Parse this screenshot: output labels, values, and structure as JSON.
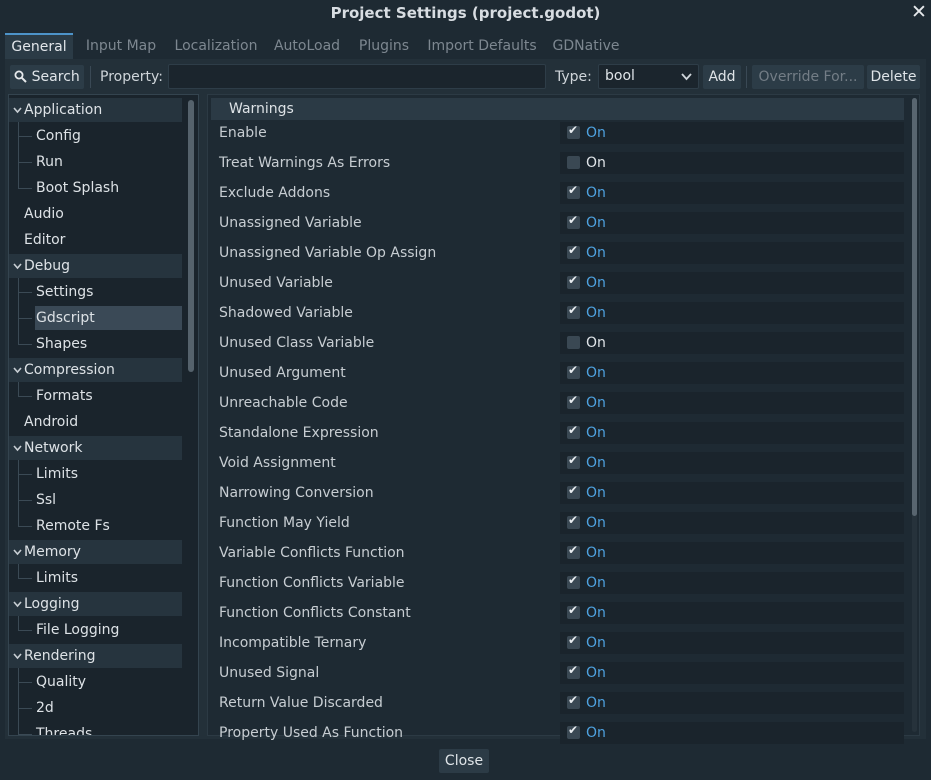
{
  "window": {
    "title": "Project Settings (project.godot)",
    "close_symbol": "✕"
  },
  "tabs": [
    {
      "label": "General",
      "active": true
    },
    {
      "label": "Input Map"
    },
    {
      "label": "Localization"
    },
    {
      "label": "AutoLoad"
    },
    {
      "label": "Plugins"
    },
    {
      "label": "Import Defaults"
    },
    {
      "label": "GDNative"
    }
  ],
  "toolbar": {
    "search_label": "Search",
    "property_label": "Property:",
    "property_value": "",
    "type_label": "Type:",
    "type_value": "bool",
    "add_label": "Add",
    "override_label": "Override For...",
    "delete_label": "Delete"
  },
  "tree": [
    {
      "label": "Application",
      "level": 0,
      "section": true
    },
    {
      "label": "Config",
      "level": 1
    },
    {
      "label": "Run",
      "level": 1
    },
    {
      "label": "Boot Splash",
      "level": 1
    },
    {
      "label": "Audio",
      "level": 0
    },
    {
      "label": "Editor",
      "level": 0
    },
    {
      "label": "Debug",
      "level": 0,
      "section": true
    },
    {
      "label": "Settings",
      "level": 1
    },
    {
      "label": "Gdscript",
      "level": 1,
      "selected": true
    },
    {
      "label": "Shapes",
      "level": 1
    },
    {
      "label": "Compression",
      "level": 0,
      "section": true
    },
    {
      "label": "Formats",
      "level": 1
    },
    {
      "label": "Android",
      "level": 0
    },
    {
      "label": "Network",
      "level": 0,
      "section": true
    },
    {
      "label": "Limits",
      "level": 1
    },
    {
      "label": "Ssl",
      "level": 1
    },
    {
      "label": "Remote Fs",
      "level": 1
    },
    {
      "label": "Memory",
      "level": 0,
      "section": true
    },
    {
      "label": "Limits",
      "level": 1
    },
    {
      "label": "Logging",
      "level": 0,
      "section": true
    },
    {
      "label": "File Logging",
      "level": 1
    },
    {
      "label": "Rendering",
      "level": 0,
      "section": true
    },
    {
      "label": "Quality",
      "level": 1
    },
    {
      "label": "2d",
      "level": 1
    },
    {
      "label": "Threads",
      "level": 1
    }
  ],
  "inspector": {
    "section_title": "Warnings",
    "properties": [
      {
        "label": "Enable",
        "checked": true,
        "value": "On"
      },
      {
        "label": "Treat Warnings As Errors",
        "checked": false,
        "value": "On"
      },
      {
        "label": "Exclude Addons",
        "checked": true,
        "value": "On"
      },
      {
        "label": "Unassigned Variable",
        "checked": true,
        "value": "On"
      },
      {
        "label": "Unassigned Variable Op Assign",
        "checked": true,
        "value": "On"
      },
      {
        "label": "Unused Variable",
        "checked": true,
        "value": "On"
      },
      {
        "label": "Shadowed Variable",
        "checked": true,
        "value": "On"
      },
      {
        "label": "Unused Class Variable",
        "checked": false,
        "value": "On"
      },
      {
        "label": "Unused Argument",
        "checked": true,
        "value": "On"
      },
      {
        "label": "Unreachable Code",
        "checked": true,
        "value": "On"
      },
      {
        "label": "Standalone Expression",
        "checked": true,
        "value": "On"
      },
      {
        "label": "Void Assignment",
        "checked": true,
        "value": "On"
      },
      {
        "label": "Narrowing Conversion",
        "checked": true,
        "value": "On"
      },
      {
        "label": "Function May Yield",
        "checked": true,
        "value": "On"
      },
      {
        "label": "Variable Conflicts Function",
        "checked": true,
        "value": "On"
      },
      {
        "label": "Function Conflicts Variable",
        "checked": true,
        "value": "On"
      },
      {
        "label": "Function Conflicts Constant",
        "checked": true,
        "value": "On"
      },
      {
        "label": "Incompatible Ternary",
        "checked": true,
        "value": "On"
      },
      {
        "label": "Unused Signal",
        "checked": true,
        "value": "On"
      },
      {
        "label": "Return Value Discarded",
        "checked": true,
        "value": "On"
      },
      {
        "label": "Property Used As Function",
        "checked": true,
        "value": "On"
      }
    ]
  },
  "footer": {
    "close_label": "Close"
  }
}
